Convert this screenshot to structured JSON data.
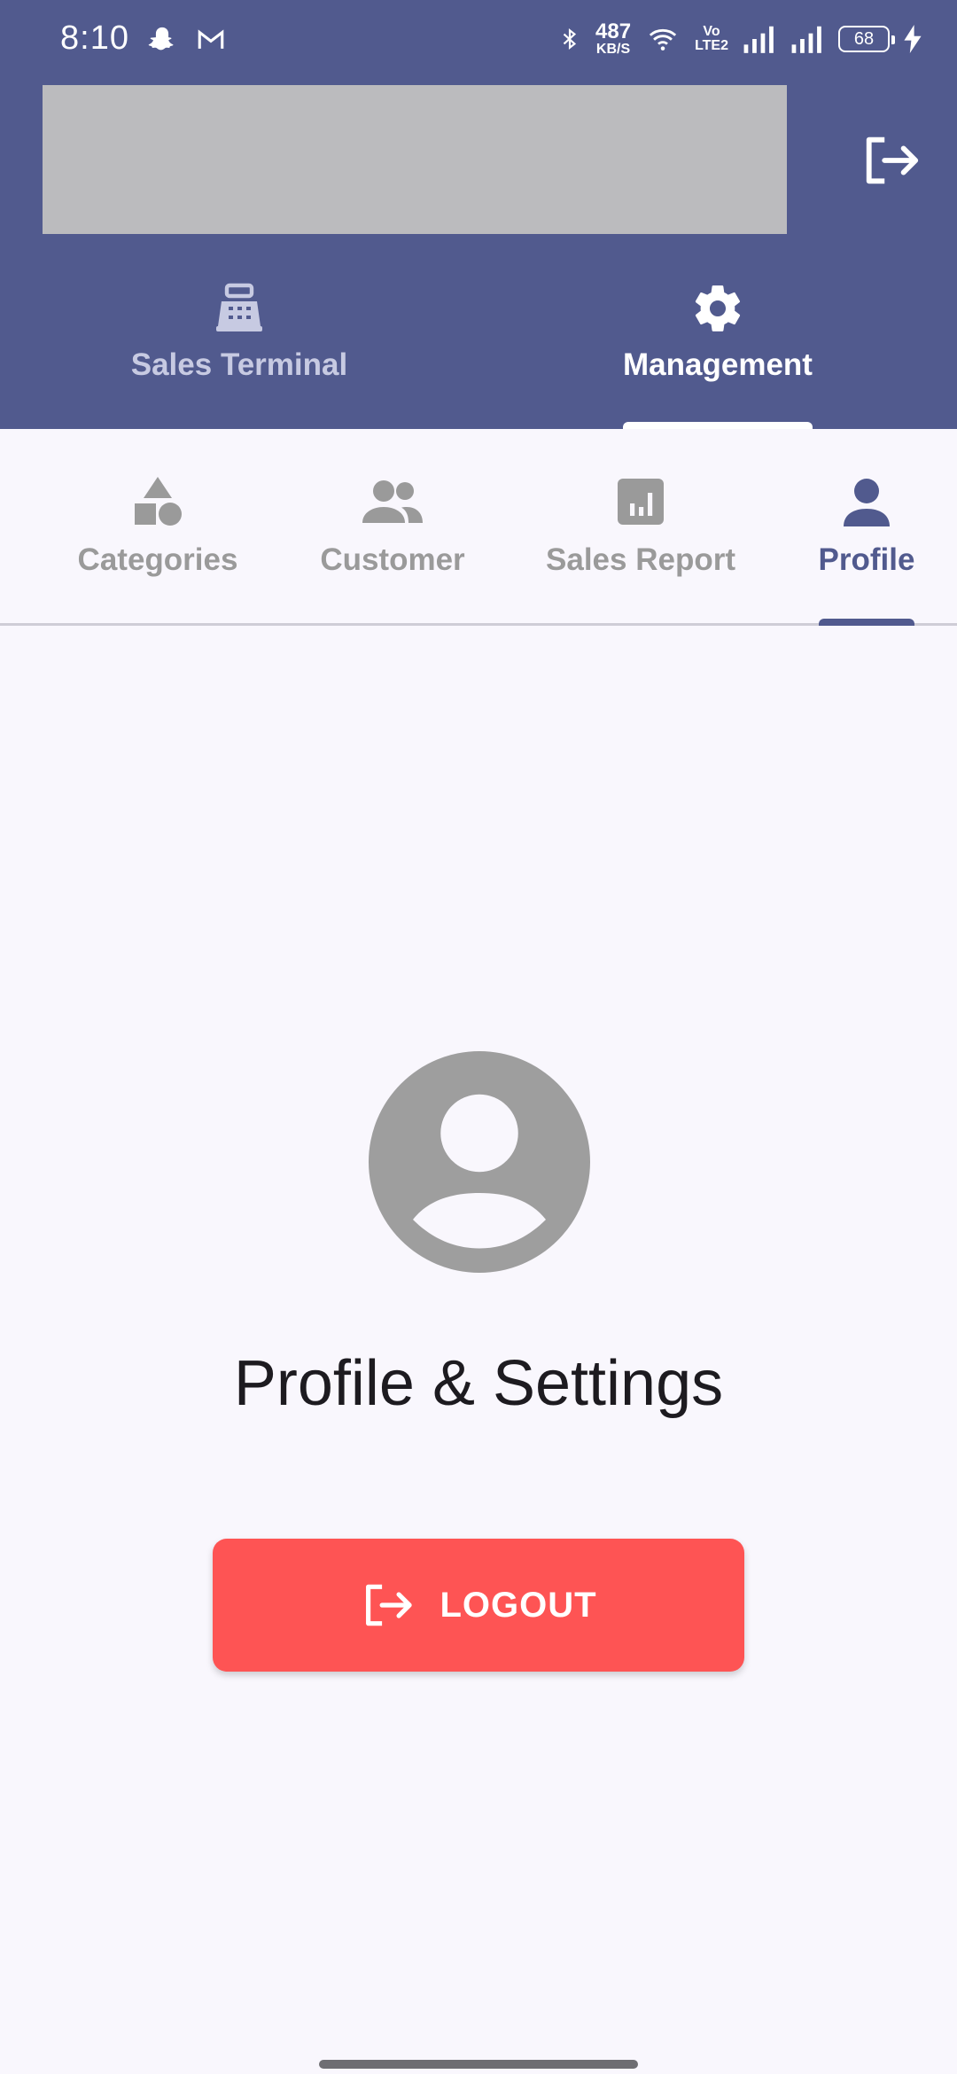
{
  "status_bar": {
    "time": "8:10",
    "left_icons": [
      "snapchat-icon",
      "gmail-icon"
    ],
    "net_speed_value": "487",
    "net_speed_unit": "KB/S",
    "volte_top": "Vo",
    "volte_bottom": "LTE2",
    "battery_level": "68",
    "right_icons": [
      "bluetooth-icon",
      "wifi-icon",
      "signal-icon",
      "signal-icon",
      "battery-icon",
      "charging-icon"
    ]
  },
  "header": {
    "logout_icon": "logout-icon"
  },
  "top_tabs": [
    {
      "label": "Sales Terminal",
      "icon": "cash-register-icon",
      "active": false
    },
    {
      "label": "Management",
      "icon": "gear-icon",
      "active": true
    }
  ],
  "sub_tabs": [
    {
      "label": "Categories",
      "icon": "shapes-icon",
      "active": false
    },
    {
      "label": "Customer",
      "icon": "people-icon",
      "active": false
    },
    {
      "label": "Sales Report",
      "icon": "bar-chart-icon",
      "active": false
    },
    {
      "label": "Profile",
      "icon": "person-icon",
      "active": true
    }
  ],
  "main": {
    "avatar_icon": "account-circle-icon",
    "title": "Profile & Settings",
    "logout_button_label": "LOGOUT"
  },
  "colors": {
    "primary": "#515a8e",
    "logout_red": "#fe5454",
    "inactive_gray": "#9a9a9a",
    "background": "#f9f7fd"
  }
}
